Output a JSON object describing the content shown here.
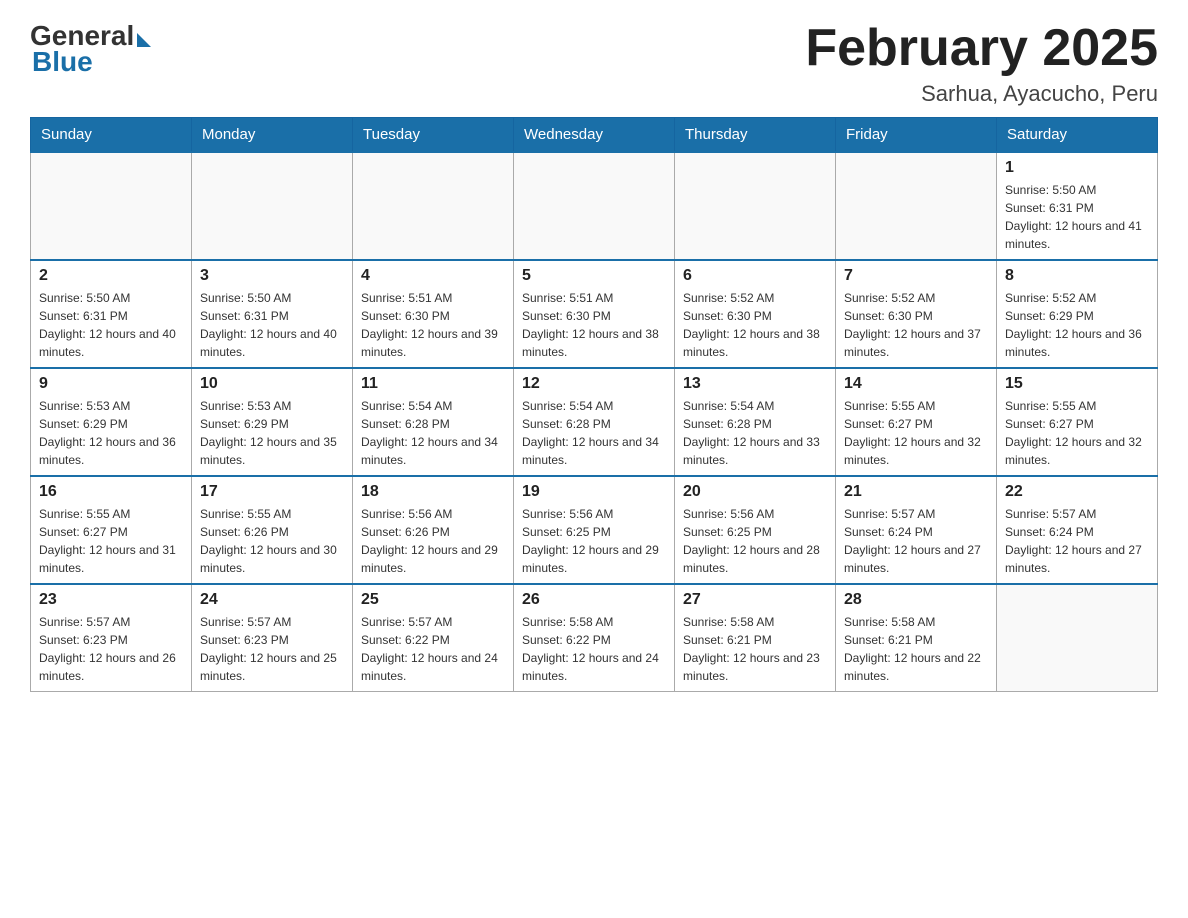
{
  "header": {
    "logo_general": "General",
    "logo_blue": "Blue",
    "title": "February 2025",
    "subtitle": "Sarhua, Ayacucho, Peru"
  },
  "days_of_week": [
    "Sunday",
    "Monday",
    "Tuesday",
    "Wednesday",
    "Thursday",
    "Friday",
    "Saturday"
  ],
  "weeks": [
    [
      {
        "day": "",
        "info": ""
      },
      {
        "day": "",
        "info": ""
      },
      {
        "day": "",
        "info": ""
      },
      {
        "day": "",
        "info": ""
      },
      {
        "day": "",
        "info": ""
      },
      {
        "day": "",
        "info": ""
      },
      {
        "day": "1",
        "info": "Sunrise: 5:50 AM\nSunset: 6:31 PM\nDaylight: 12 hours and 41 minutes."
      }
    ],
    [
      {
        "day": "2",
        "info": "Sunrise: 5:50 AM\nSunset: 6:31 PM\nDaylight: 12 hours and 40 minutes."
      },
      {
        "day": "3",
        "info": "Sunrise: 5:50 AM\nSunset: 6:31 PM\nDaylight: 12 hours and 40 minutes."
      },
      {
        "day": "4",
        "info": "Sunrise: 5:51 AM\nSunset: 6:30 PM\nDaylight: 12 hours and 39 minutes."
      },
      {
        "day": "5",
        "info": "Sunrise: 5:51 AM\nSunset: 6:30 PM\nDaylight: 12 hours and 38 minutes."
      },
      {
        "day": "6",
        "info": "Sunrise: 5:52 AM\nSunset: 6:30 PM\nDaylight: 12 hours and 38 minutes."
      },
      {
        "day": "7",
        "info": "Sunrise: 5:52 AM\nSunset: 6:30 PM\nDaylight: 12 hours and 37 minutes."
      },
      {
        "day": "8",
        "info": "Sunrise: 5:52 AM\nSunset: 6:29 PM\nDaylight: 12 hours and 36 minutes."
      }
    ],
    [
      {
        "day": "9",
        "info": "Sunrise: 5:53 AM\nSunset: 6:29 PM\nDaylight: 12 hours and 36 minutes."
      },
      {
        "day": "10",
        "info": "Sunrise: 5:53 AM\nSunset: 6:29 PM\nDaylight: 12 hours and 35 minutes."
      },
      {
        "day": "11",
        "info": "Sunrise: 5:54 AM\nSunset: 6:28 PM\nDaylight: 12 hours and 34 minutes."
      },
      {
        "day": "12",
        "info": "Sunrise: 5:54 AM\nSunset: 6:28 PM\nDaylight: 12 hours and 34 minutes."
      },
      {
        "day": "13",
        "info": "Sunrise: 5:54 AM\nSunset: 6:28 PM\nDaylight: 12 hours and 33 minutes."
      },
      {
        "day": "14",
        "info": "Sunrise: 5:55 AM\nSunset: 6:27 PM\nDaylight: 12 hours and 32 minutes."
      },
      {
        "day": "15",
        "info": "Sunrise: 5:55 AM\nSunset: 6:27 PM\nDaylight: 12 hours and 32 minutes."
      }
    ],
    [
      {
        "day": "16",
        "info": "Sunrise: 5:55 AM\nSunset: 6:27 PM\nDaylight: 12 hours and 31 minutes."
      },
      {
        "day": "17",
        "info": "Sunrise: 5:55 AM\nSunset: 6:26 PM\nDaylight: 12 hours and 30 minutes."
      },
      {
        "day": "18",
        "info": "Sunrise: 5:56 AM\nSunset: 6:26 PM\nDaylight: 12 hours and 29 minutes."
      },
      {
        "day": "19",
        "info": "Sunrise: 5:56 AM\nSunset: 6:25 PM\nDaylight: 12 hours and 29 minutes."
      },
      {
        "day": "20",
        "info": "Sunrise: 5:56 AM\nSunset: 6:25 PM\nDaylight: 12 hours and 28 minutes."
      },
      {
        "day": "21",
        "info": "Sunrise: 5:57 AM\nSunset: 6:24 PM\nDaylight: 12 hours and 27 minutes."
      },
      {
        "day": "22",
        "info": "Sunrise: 5:57 AM\nSunset: 6:24 PM\nDaylight: 12 hours and 27 minutes."
      }
    ],
    [
      {
        "day": "23",
        "info": "Sunrise: 5:57 AM\nSunset: 6:23 PM\nDaylight: 12 hours and 26 minutes."
      },
      {
        "day": "24",
        "info": "Sunrise: 5:57 AM\nSunset: 6:23 PM\nDaylight: 12 hours and 25 minutes."
      },
      {
        "day": "25",
        "info": "Sunrise: 5:57 AM\nSunset: 6:22 PM\nDaylight: 12 hours and 24 minutes."
      },
      {
        "day": "26",
        "info": "Sunrise: 5:58 AM\nSunset: 6:22 PM\nDaylight: 12 hours and 24 minutes."
      },
      {
        "day": "27",
        "info": "Sunrise: 5:58 AM\nSunset: 6:21 PM\nDaylight: 12 hours and 23 minutes."
      },
      {
        "day": "28",
        "info": "Sunrise: 5:58 AM\nSunset: 6:21 PM\nDaylight: 12 hours and 22 minutes."
      },
      {
        "day": "",
        "info": ""
      }
    ]
  ]
}
